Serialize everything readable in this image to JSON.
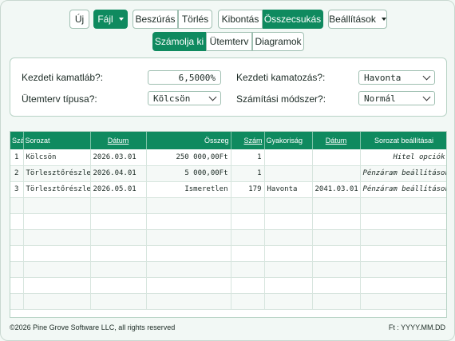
{
  "toolbar": {
    "new_label": "Új",
    "file_label": "Fájl",
    "insert_label": "Beszúrás",
    "delete_label": "Törlés",
    "expand_label": "Kibontás",
    "collapse_label": "Összecsukás",
    "settings_label": "Beállítások"
  },
  "tabs": {
    "calculate": "Számolja ki",
    "schedule": "Ütemterv",
    "charts": "Diagramok"
  },
  "form": {
    "rate_label": "Kezdeti kamatláb?:",
    "rate_value": "6,5000%",
    "compounding_label": "Kezdeti kamatozás?:",
    "compounding_value": "Havonta",
    "schedule_type_label": "Ütemterv típusa?:",
    "schedule_type_value": "Kölcsön",
    "method_label": "Számítási módszer?:",
    "method_value": "Normál"
  },
  "table": {
    "headers": [
      "Szám",
      "Sorozat",
      "Dátum",
      "Összeg",
      "Szám",
      "Gyakoriság",
      "Dátum",
      "Sorozat beállításai"
    ],
    "rows": [
      [
        "1",
        "Kölcsön",
        "2026.03.01",
        "250 000,00Ft",
        "1",
        "",
        "",
        "Hitel opciók"
      ],
      [
        "2",
        "Törlesztőrészlet",
        "2026.04.01",
        "5 000,00Ft",
        "1",
        "",
        "",
        "Pénzáram beállítások"
      ],
      [
        "3",
        "Törlesztőrészlet",
        "2026.05.01",
        "Ismeretlen",
        "179",
        "Havonta",
        "2041.03.01",
        "Pénzáram beállítások"
      ]
    ]
  },
  "footer": {
    "copyright": "©2026 Pine Grove Software LLC, all rights reserved",
    "date_format": "Ft : YYYY.MM.DD"
  },
  "colors": {
    "accent": "#0f8a5f",
    "background": "#f2f8f5"
  }
}
